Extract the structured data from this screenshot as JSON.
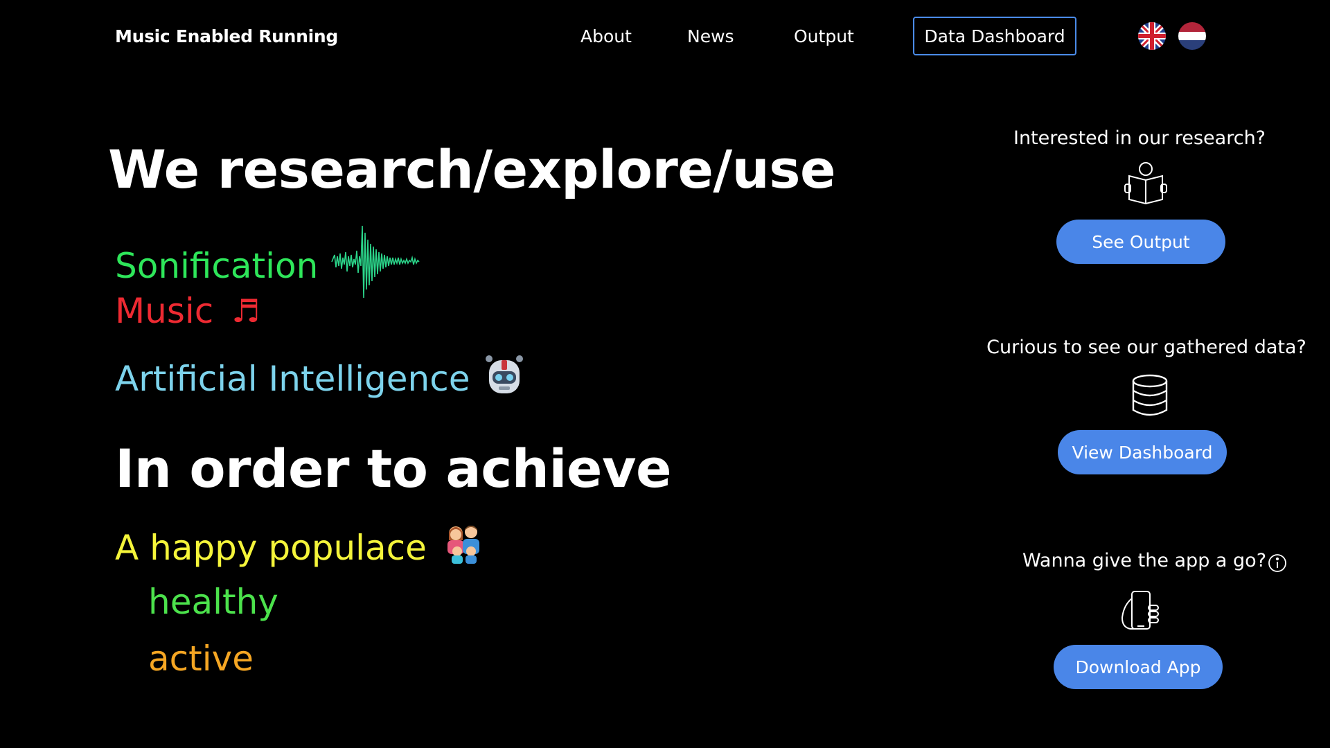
{
  "nav": {
    "brand": "Music Enabled Running",
    "links": [
      {
        "label": "About"
      },
      {
        "label": "News"
      },
      {
        "label": "Output"
      }
    ],
    "dashboard_button": "Data Dashboard",
    "languages": [
      "uk-flag-icon",
      "nl-flag-icon"
    ]
  },
  "hero": {
    "heading": "We research/explore/use",
    "items": [
      {
        "label": "Sonification",
        "color": "#2ee65a",
        "icon": "waveform-icon"
      },
      {
        "label": "Music",
        "color": "#ee2a32",
        "icon": "music-note-icon",
        "glyph": "♬"
      },
      {
        "label": "Artificial Intelligence",
        "color": "#7dd3ec",
        "icon": "robot-icon"
      }
    ],
    "subheading": "In order to achieve",
    "goals": [
      {
        "label": "A happy populace",
        "color": "#f5f53a",
        "icon": "family-icon"
      },
      {
        "label": "healthy",
        "color": "#4ce24c"
      },
      {
        "label": "active",
        "color": "#f5a623"
      }
    ]
  },
  "cards": {
    "research": {
      "title": "Interested in our research?",
      "icon": "book-reader-icon",
      "button": "See Output"
    },
    "data": {
      "title": "Curious to see our gathered data?",
      "icon": "database-icon",
      "button": "View Dashboard"
    },
    "app": {
      "title": "Wanna give the app a go?",
      "icon": "phone-in-hand-icon",
      "info_icon": "info-icon",
      "button": "Download App"
    }
  },
  "colors": {
    "background": "#000000",
    "accent": "#4a86e8"
  }
}
